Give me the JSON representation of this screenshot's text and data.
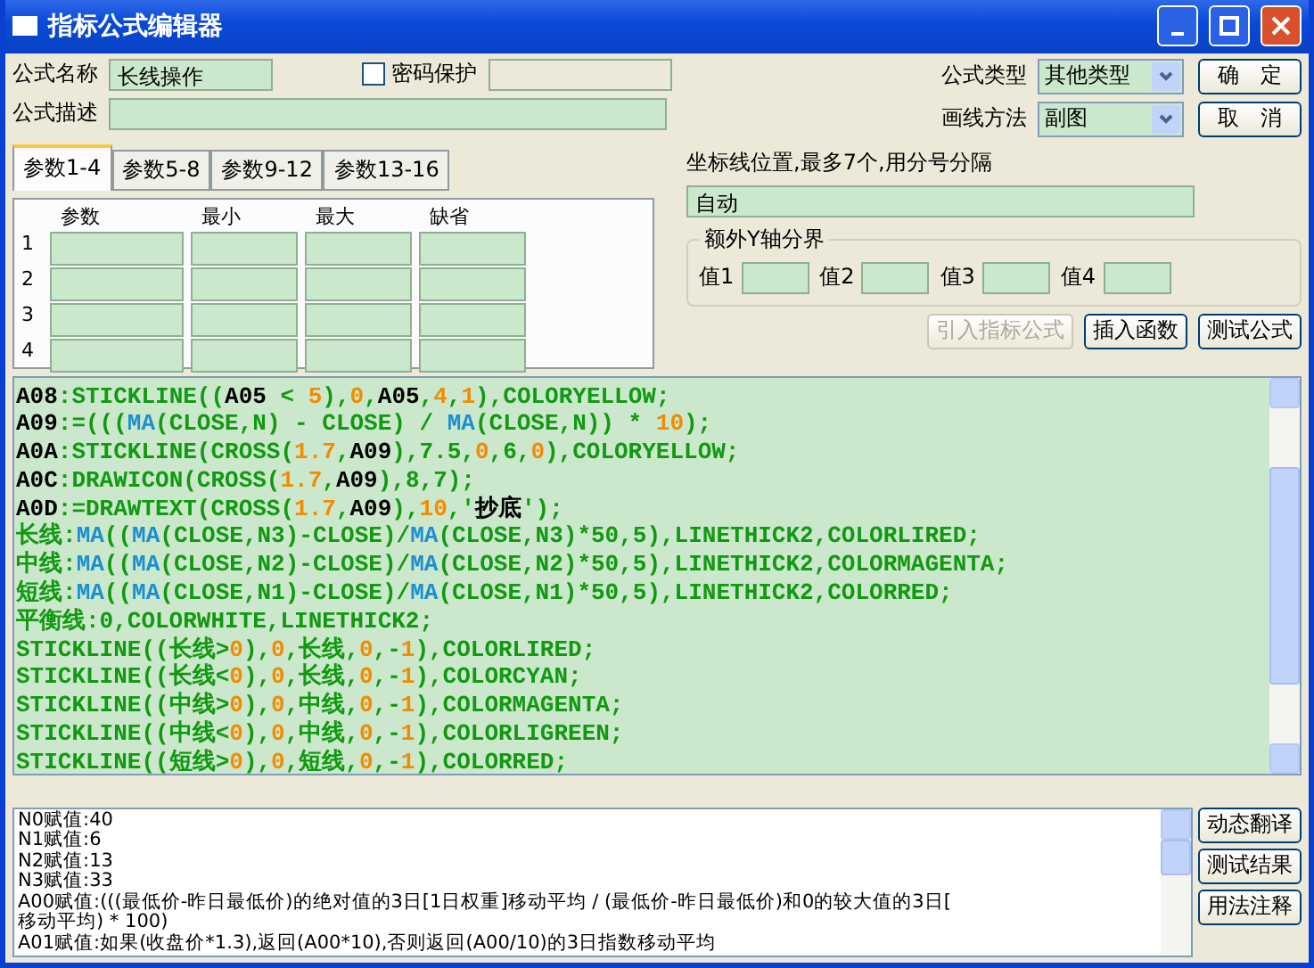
{
  "window": {
    "title": "指标公式编辑器"
  },
  "formula_name": {
    "label": "公式名称",
    "value": "长线操作"
  },
  "password": {
    "label": "密码保护",
    "checked": false
  },
  "formula_desc": {
    "label": "公式描述"
  },
  "formula_type": {
    "label": "公式类型",
    "value": "其他类型"
  },
  "draw_method": {
    "label": "画线方法",
    "value": "副图"
  },
  "buttons_top": [
    "确　定",
    "取　消"
  ],
  "tabs": [
    {
      "label": "参数1-4",
      "selected": true
    },
    {
      "label": "参数5-8",
      "selected": false
    },
    {
      "label": "参数9-12",
      "selected": false
    },
    {
      "label": "参数13-16",
      "selected": false
    }
  ],
  "params": {
    "columns": [
      "参数",
      "最小",
      "最大",
      "缺省"
    ],
    "rows": [
      "1",
      "2",
      "3",
      "4"
    ]
  },
  "axis_lines": {
    "label": "坐标线位置,最多7个,用分号分隔",
    "value": "自动"
  },
  "y_bounds": {
    "title": "额外Y轴分界",
    "labels": [
      "值1",
      "值2",
      "值3",
      "值4"
    ]
  },
  "tool_buttons": [
    {
      "label": "引入指标公式",
      "disabled": true
    },
    {
      "label": "插入函数",
      "disabled": false
    },
    {
      "label": "测试公式",
      "disabled": false
    }
  ],
  "code_lines": [
    [
      {
        "kind": "name",
        "text": "A08"
      },
      {
        "kind": "code",
        "text": ":STICKLINE(("
      },
      {
        "kind": "name",
        "text": "A05"
      },
      {
        "kind": "code",
        "text": " < "
      },
      {
        "kind": "num",
        "text": "5"
      },
      {
        "kind": "code",
        "text": "),"
      },
      {
        "kind": "num",
        "text": "0"
      },
      {
        "kind": "code",
        "text": ","
      },
      {
        "kind": "name",
        "text": "A05"
      },
      {
        "kind": "code",
        "text": ","
      },
      {
        "kind": "num",
        "text": "4"
      },
      {
        "kind": "code",
        "text": ","
      },
      {
        "kind": "num",
        "text": "1"
      },
      {
        "kind": "code",
        "text": "),COLORYELLOW;"
      }
    ],
    [
      {
        "kind": "name",
        "text": "A09"
      },
      {
        "kind": "code",
        "text": ":=((("
      },
      {
        "kind": "func",
        "text": "MA"
      },
      {
        "kind": "code",
        "text": "(CLOSE,N) - CLOSE) / "
      },
      {
        "kind": "func",
        "text": "MA"
      },
      {
        "kind": "code",
        "text": "(CLOSE,N)) * "
      },
      {
        "kind": "num",
        "text": "10"
      },
      {
        "kind": "code",
        "text": ");"
      }
    ],
    [
      {
        "kind": "name",
        "text": "A0A"
      },
      {
        "kind": "code",
        "text": ":STICKLINE(CROSS("
      },
      {
        "kind": "num",
        "text": "1.7"
      },
      {
        "kind": "code",
        "text": ","
      },
      {
        "kind": "name",
        "text": "A09"
      },
      {
        "kind": "code",
        "text": "),7.5,"
      },
      {
        "kind": "num",
        "text": "0"
      },
      {
        "kind": "code",
        "text": ",6,"
      },
      {
        "kind": "num",
        "text": "0"
      },
      {
        "kind": "code",
        "text": "),COLORYELLOW;"
      }
    ],
    [
      {
        "kind": "name",
        "text": "A0C"
      },
      {
        "kind": "code",
        "text": ":DRAWICON(CROSS("
      },
      {
        "kind": "num",
        "text": "1.7"
      },
      {
        "kind": "code",
        "text": ","
      },
      {
        "kind": "name",
        "text": "A09"
      },
      {
        "kind": "code",
        "text": "),8,7);"
      }
    ],
    [
      {
        "kind": "name",
        "text": "A0D"
      },
      {
        "kind": "code",
        "text": ":=DRAWTEXT(CROSS("
      },
      {
        "kind": "num",
        "text": "1.7"
      },
      {
        "kind": "code",
        "text": ","
      },
      {
        "kind": "name",
        "text": "A09"
      },
      {
        "kind": "code",
        "text": "),"
      },
      {
        "kind": "num",
        "text": "10"
      },
      {
        "kind": "code",
        "text": ",'"
      },
      {
        "kind": "name",
        "text": "抄底"
      },
      {
        "kind": "code",
        "text": "');"
      }
    ],
    [
      {
        "kind": "code",
        "text": "长线:"
      },
      {
        "kind": "func",
        "text": "MA"
      },
      {
        "kind": "code",
        "text": "(("
      },
      {
        "kind": "func",
        "text": "MA"
      },
      {
        "kind": "code",
        "text": "(CLOSE,N3)-CLOSE)/"
      },
      {
        "kind": "func",
        "text": "MA"
      },
      {
        "kind": "code",
        "text": "(CLOSE,N3)*50,5),LINETHICK2,COLORLIRED;"
      }
    ],
    [
      {
        "kind": "code",
        "text": "中线:"
      },
      {
        "kind": "func",
        "text": "MA"
      },
      {
        "kind": "code",
        "text": "(("
      },
      {
        "kind": "func",
        "text": "MA"
      },
      {
        "kind": "code",
        "text": "(CLOSE,N2)-CLOSE)/"
      },
      {
        "kind": "func",
        "text": "MA"
      },
      {
        "kind": "code",
        "text": "(CLOSE,N2)*50,5),LINETHICK2,COLORMAGENTA;"
      }
    ],
    [
      {
        "kind": "code",
        "text": "短线:"
      },
      {
        "kind": "func",
        "text": "MA"
      },
      {
        "kind": "code",
        "text": "(("
      },
      {
        "kind": "func",
        "text": "MA"
      },
      {
        "kind": "code",
        "text": "(CLOSE,N1)-CLOSE)/"
      },
      {
        "kind": "func",
        "text": "MA"
      },
      {
        "kind": "code",
        "text": "(CLOSE,N1)*50,5),LINETHICK2,COLORRED;"
      }
    ],
    [
      {
        "kind": "code",
        "text": "平衡线:0,COLORWHITE,LINETHICK2;"
      }
    ],
    [
      {
        "kind": "code",
        "text": "STICKLINE((长线>"
      },
      {
        "kind": "num",
        "text": "0"
      },
      {
        "kind": "code",
        "text": "),"
      },
      {
        "kind": "num",
        "text": "0"
      },
      {
        "kind": "code",
        "text": ",长线,"
      },
      {
        "kind": "num",
        "text": "0"
      },
      {
        "kind": "code",
        "text": ",-"
      },
      {
        "kind": "num",
        "text": "1"
      },
      {
        "kind": "code",
        "text": "),COLORLIRED;"
      }
    ],
    [
      {
        "kind": "code",
        "text": "STICKLINE((长线<"
      },
      {
        "kind": "num",
        "text": "0"
      },
      {
        "kind": "code",
        "text": "),"
      },
      {
        "kind": "num",
        "text": "0"
      },
      {
        "kind": "code",
        "text": ",长线,"
      },
      {
        "kind": "num",
        "text": "0"
      },
      {
        "kind": "code",
        "text": ",-"
      },
      {
        "kind": "num",
        "text": "1"
      },
      {
        "kind": "code",
        "text": "),COLORCYAN;"
      }
    ],
    [
      {
        "kind": "code",
        "text": "STICKLINE((中线>"
      },
      {
        "kind": "num",
        "text": "0"
      },
      {
        "kind": "code",
        "text": "),"
      },
      {
        "kind": "num",
        "text": "0"
      },
      {
        "kind": "code",
        "text": ",中线,"
      },
      {
        "kind": "num",
        "text": "0"
      },
      {
        "kind": "code",
        "text": ",-"
      },
      {
        "kind": "num",
        "text": "1"
      },
      {
        "kind": "code",
        "text": "),COLORMAGENTA;"
      }
    ],
    [
      {
        "kind": "code",
        "text": "STICKLINE((中线<"
      },
      {
        "kind": "num",
        "text": "0"
      },
      {
        "kind": "code",
        "text": "),"
      },
      {
        "kind": "num",
        "text": "0"
      },
      {
        "kind": "code",
        "text": ",中线,"
      },
      {
        "kind": "num",
        "text": "0"
      },
      {
        "kind": "code",
        "text": ",-"
      },
      {
        "kind": "num",
        "text": "1"
      },
      {
        "kind": "code",
        "text": "),COLORLIGREEN;"
      }
    ],
    [
      {
        "kind": "code",
        "text": "STICKLINE((短线>"
      },
      {
        "kind": "num",
        "text": "0"
      },
      {
        "kind": "code",
        "text": "),"
      },
      {
        "kind": "num",
        "text": "0"
      },
      {
        "kind": "code",
        "text": ",短线,"
      },
      {
        "kind": "num",
        "text": "0"
      },
      {
        "kind": "code",
        "text": ",-"
      },
      {
        "kind": "num",
        "text": "1"
      },
      {
        "kind": "code",
        "text": "),COLORRED;"
      }
    ]
  ],
  "output_lines": [
    "N0赋值:40",
    "N1赋值:6",
    "N2赋值:13",
    "N3赋值:33",
    "A00赋值:(((最低价-昨日最低价)的绝对值的3日[1日权重]移动平均 / (最低价-昨日最低价)和0的较大值的3日[",
    "移动平均) * 100)",
    "A01赋值:如果(收盘价*1.3),返回(A00*10),否则返回(A00/10)的3日指数移动平均"
  ],
  "side_buttons": [
    "动态翻译",
    "测试结果",
    "用法注释"
  ]
}
